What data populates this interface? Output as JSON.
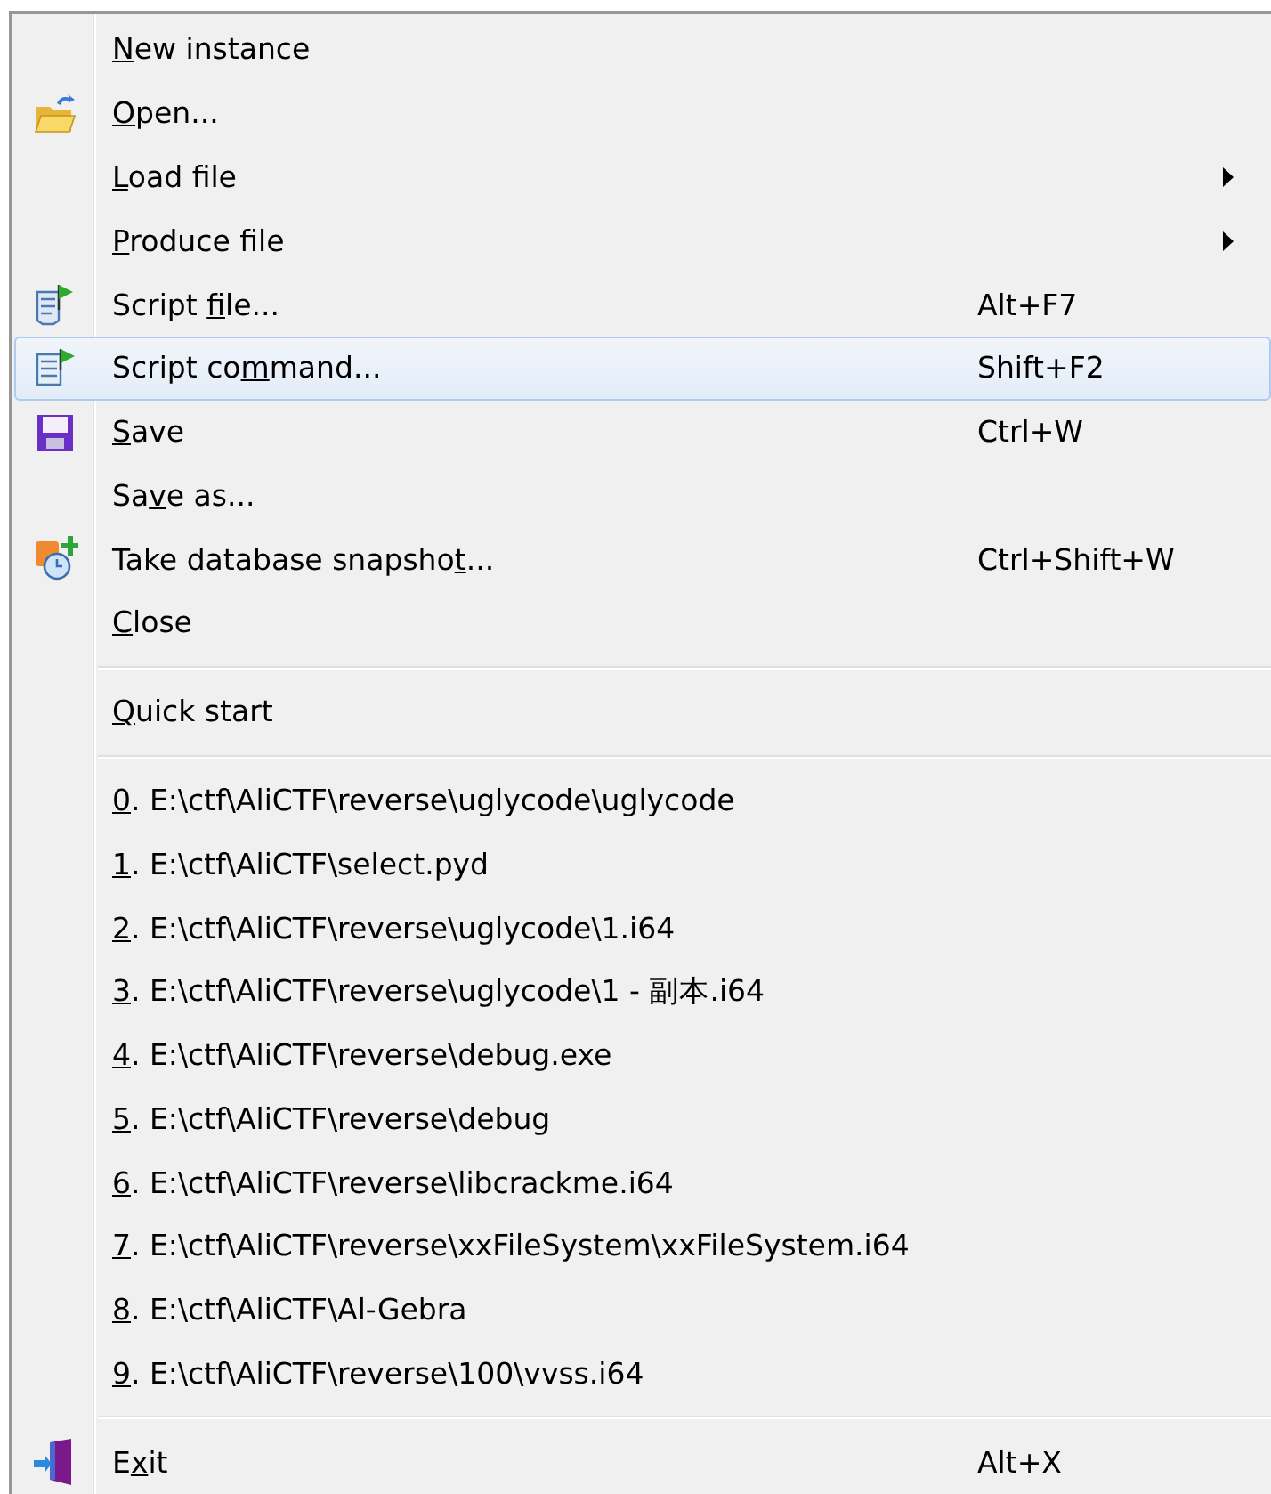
{
  "menu": {
    "sections": [
      {
        "items": [
          {
            "access_key": "N",
            "text_after": "ew instance",
            "selected": false
          },
          {
            "kind": "folder",
            "access_key": "O",
            "text_after": "pen...",
            "selected": false
          },
          {
            "access_key": "L",
            "text_after": "oad file",
            "submenu": true,
            "selected": false
          },
          {
            "access_key": "P",
            "text_after": "roduce file",
            "submenu": true,
            "selected": false
          },
          {
            "kind": "script",
            "text_before": "Script ",
            "access_key": "f",
            "text_after": "ile...",
            "shortcut": "Alt+F7",
            "selected": false
          },
          {
            "kind": "script-page",
            "text_before": "Script co",
            "access_key": "m",
            "text_after": "mand...",
            "shortcut": "Shift+F2",
            "selected": true
          },
          {
            "kind": "save",
            "access_key": "S",
            "text_after": "ave",
            "shortcut": "Ctrl+W",
            "selected": false
          },
          {
            "text_before": "Sa",
            "access_key": "v",
            "text_after": "e as...",
            "selected": false
          },
          {
            "kind": "snapshot",
            "text_before": "Take database snapsho",
            "access_key": "t",
            "text_after": "...",
            "shortcut": "Ctrl+Shift+W",
            "selected": false
          },
          {
            "access_key": "C",
            "text_after": "lose",
            "selected": false
          }
        ]
      },
      {
        "items": [
          {
            "access_key": "Q",
            "text_after": "uick start",
            "selected": false
          }
        ]
      },
      {
        "items": [
          {
            "access_key": "0",
            "text_after": ". E:\\ctf\\AliCTF\\reverse\\uglycode\\uglycode",
            "selected": false
          },
          {
            "access_key": "1",
            "text_after": ". E:\\ctf\\AliCTF\\select.pyd",
            "selected": false
          },
          {
            "access_key": "2",
            "text_after": ". E:\\ctf\\AliCTF\\reverse\\uglycode\\1.i64",
            "selected": false
          },
          {
            "access_key": "3",
            "text_after": ". E:\\ctf\\AliCTF\\reverse\\uglycode\\1 - 副本.i64",
            "selected": false
          },
          {
            "access_key": "4",
            "text_after": ". E:\\ctf\\AliCTF\\reverse\\debug.exe",
            "selected": false
          },
          {
            "access_key": "5",
            "text_after": ". E:\\ctf\\AliCTF\\reverse\\debug",
            "selected": false
          },
          {
            "access_key": "6",
            "text_after": ". E:\\ctf\\AliCTF\\reverse\\libcrackme.i64",
            "selected": false
          },
          {
            "access_key": "7",
            "text_after": ". E:\\ctf\\AliCTF\\reverse\\xxFileSystem\\xxFileSystem.i64",
            "selected": false
          },
          {
            "access_key": "8",
            "text_after": ". E:\\ctf\\AliCTF\\Al-Gebra",
            "selected": false
          },
          {
            "access_key": "9",
            "text_after": ". E:\\ctf\\AliCTF\\reverse\\100\\vvss.i64",
            "selected": false
          }
        ]
      },
      {
        "items": [
          {
            "kind": "exit",
            "text_before": "E",
            "access_key": "x",
            "text_after": "it",
            "shortcut": "Alt+X",
            "selected": false
          }
        ]
      }
    ]
  }
}
